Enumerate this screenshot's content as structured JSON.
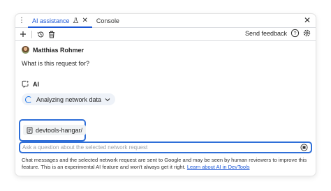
{
  "tabs": [
    {
      "label": "AI assistance",
      "active": true
    },
    {
      "label": "Console",
      "active": false
    }
  ],
  "toolbar": {
    "send_feedback": "Send feedback"
  },
  "conversation": {
    "user_name": "Matthias Rohmer",
    "user_question": "What is this request for?",
    "ai_label": "AI",
    "status_text": "Analyzing network data"
  },
  "context": {
    "chip_label": "devtools-hangar/"
  },
  "input": {
    "placeholder": "Ask a question about the selected network request",
    "value": ""
  },
  "disclaimer": {
    "text": "Chat messages and the selected network request are sent to Google and may be seen by human reviewers to improve this feature. This is an experimental AI feature and won't always get it right. ",
    "link": "Learn about AI in DevTools"
  },
  "colors": {
    "accent": "#1a56d6",
    "highlight_border": "#2f6fd8",
    "chip_bg": "#eef2f8"
  }
}
